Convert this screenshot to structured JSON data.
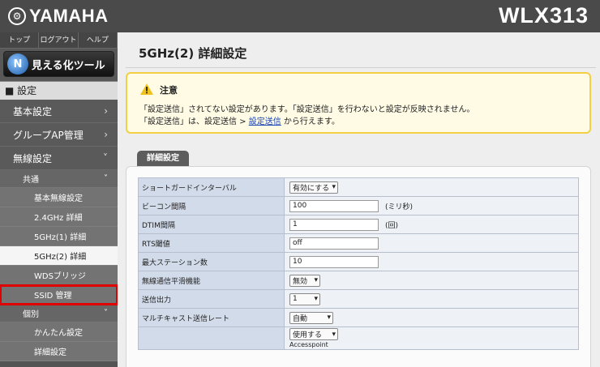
{
  "header": {
    "brand": "YAMAHA",
    "logo_glyph": "⚙",
    "model": "WLX313"
  },
  "sidebar": {
    "top_links": [
      "トップ",
      "ログアウト",
      "ヘルプ"
    ],
    "visual_tool": {
      "label": "見える化ツール",
      "icon_glyph": "N"
    },
    "section": "■ 設定",
    "menu": [
      "基本設定",
      "グループAP管理",
      "無線設定"
    ],
    "chevron_right": "›",
    "chevron_down": "˅",
    "common": {
      "label": "共通",
      "items": [
        "基本無線設定",
        "2.4GHz 詳細",
        "5GHz(1) 詳細",
        "5GHz(2) 詳細",
        "WDSブリッジ",
        "SSID 管理"
      ]
    },
    "individual": {
      "label": "個別",
      "items": [
        "かんたん設定",
        "詳細設定"
      ]
    }
  },
  "main": {
    "title": "5GHz(2) 詳細設定",
    "notice": {
      "title": "注意",
      "line1": "「設定送信」されてない設定があります。「設定送信」を行わないと設定が反映されません。",
      "line2_pre": "「設定送信」は、設定送信 > ",
      "line2_link": "設定送信",
      "line2_post": " から行えます。"
    },
    "tab": "詳細設定",
    "rows": [
      {
        "label": "ショートガードインターバル",
        "select": "有効にする"
      },
      {
        "label": "ビーコン間隔",
        "input": "100",
        "unit": "(ミリ秒)"
      },
      {
        "label": "DTIM間隔",
        "input": "1",
        "unit": "(回)"
      },
      {
        "label": "RTS閾値",
        "input": "off"
      },
      {
        "label": "最大ステーション数",
        "input": "10"
      },
      {
        "label": "無線通信平滑機能",
        "select": "無効"
      },
      {
        "label": "送信出力",
        "select": "1"
      },
      {
        "label": "マルチキャスト送信レート",
        "select": "自動"
      },
      {
        "label": "",
        "select": "使用する",
        "sub": "Accesspoint"
      }
    ],
    "select_arrow": "▾"
  },
  "colors": {
    "header": "#4a4a4a",
    "sidebar": "#535353",
    "notice_border": "#f2cf45",
    "highlight": "#e00000",
    "link": "#1a46b8"
  }
}
